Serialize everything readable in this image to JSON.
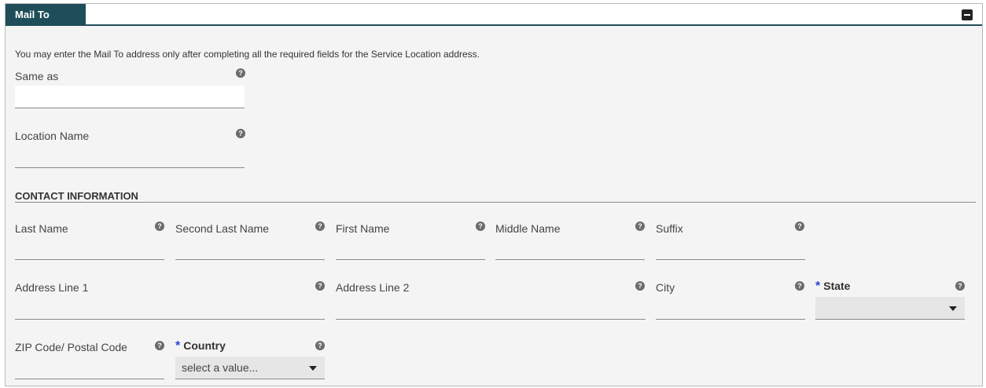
{
  "panel": {
    "tab_label": "Mail To",
    "info_text": "You may enter the Mail To address only after completing all the required fields for the Service Location address."
  },
  "fields": {
    "same_as": {
      "label": "Same as",
      "value": ""
    },
    "location_name": {
      "label": "Location Name",
      "value": ""
    },
    "section_title": "CONTACT INFORMATION",
    "last_name": {
      "label": "Last Name",
      "value": ""
    },
    "second_last_name": {
      "label": "Second Last Name",
      "value": ""
    },
    "first_name": {
      "label": "First Name",
      "value": ""
    },
    "middle_name": {
      "label": "Middle Name",
      "value": ""
    },
    "suffix": {
      "label": "Suffix",
      "value": ""
    },
    "address_line_1": {
      "label": "Address Line 1",
      "value": ""
    },
    "address_line_2": {
      "label": "Address Line 2",
      "value": ""
    },
    "city": {
      "label": "City",
      "value": ""
    },
    "state": {
      "label": "State",
      "required_mark": "*",
      "value": ""
    },
    "zip": {
      "label": "ZIP Code/ Postal Code",
      "value": ""
    },
    "country": {
      "label": "Country",
      "required_mark": "*",
      "value": "select a value..."
    }
  },
  "help_glyph": "?",
  "colors": {
    "header": "#1f4e5a",
    "required": "#2c44d6",
    "panel_bg": "#f4f4f4"
  }
}
